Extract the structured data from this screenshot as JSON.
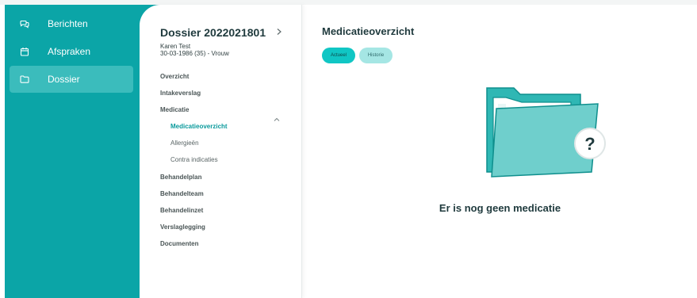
{
  "sidebar": {
    "items": [
      {
        "label": "Berichten",
        "icon": "chat-icon"
      },
      {
        "label": "Afspraken",
        "icon": "calendar-icon"
      },
      {
        "label": "Dossier",
        "icon": "folder-icon",
        "active": true
      }
    ]
  },
  "dossier": {
    "title": "Dossier 2022021801",
    "patient_name": "Karen Test",
    "patient_info": "30-03-1986 (35) - Vrouw"
  },
  "menu": {
    "overzicht": "Overzicht",
    "intakeverslag": "Intakeverslag",
    "medicatie": "Medicatie",
    "medicatie_sub": [
      "Medicatieoverzicht",
      "Allergieën",
      "Contra indicaties"
    ],
    "behandelplan": "Behandelplan",
    "behandelteam": "Behandelteam",
    "behandelinzet": "Behandelinzet",
    "verslaglegging": "Verslaglegging",
    "documenten": "Documenten"
  },
  "main": {
    "title": "Medicatieoverzicht",
    "tabs": [
      {
        "label": "Actueel",
        "active": true
      },
      {
        "label": "Historie",
        "active": false
      }
    ],
    "empty_message": "Er is nog geen medicatie"
  },
  "colors": {
    "accent": "#0ba5a7",
    "sidebar_active": "#3bbcbc",
    "pill_active": "#10c6c4",
    "pill_inactive": "#a5e6e4",
    "link_active": "#0a9a9c"
  }
}
